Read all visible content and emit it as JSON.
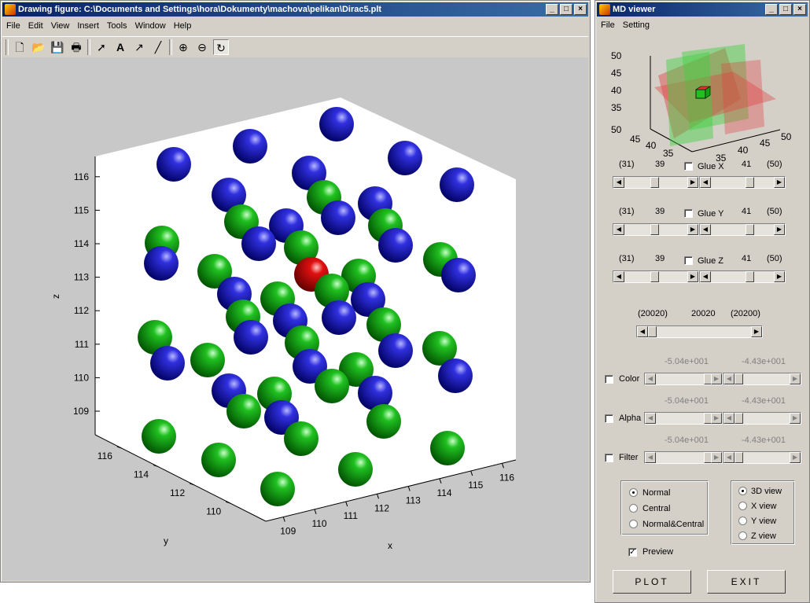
{
  "figure_window": {
    "title": "Drawing figure: C:\\Documents and Settings\\hora\\Dokumenty\\machova\\pelikan\\Dirac5.plt",
    "menu": [
      "File",
      "Edit",
      "View",
      "Insert",
      "Tools",
      "Window",
      "Help"
    ],
    "toolbar": [
      "new-file-icon",
      "open-folder-icon",
      "save-icon",
      "print-icon",
      "select-arrow-icon",
      "text-icon",
      "arrow-icon",
      "line-icon",
      "zoom-in-icon",
      "zoom-out-icon",
      "rotate-3d-icon"
    ]
  },
  "chart_data": {
    "type": "scatter",
    "title": "",
    "xlabel": "x",
    "ylabel": "y",
    "zlabel": "z",
    "x_ticks": [
      "109",
      "110",
      "111",
      "112",
      "113",
      "114",
      "115",
      "116"
    ],
    "y_ticks": [
      "110",
      "112",
      "114",
      "116"
    ],
    "z_ticks": [
      "109",
      "110",
      "111",
      "112",
      "113",
      "114",
      "115",
      "116"
    ],
    "colors": {
      "blue": "#1010b0",
      "green": "#10b010",
      "red": "#d01010",
      "background": "#c8c8c8"
    }
  },
  "viewer_window": {
    "title": "MD viewer",
    "menu": [
      "File",
      "Setting"
    ],
    "preview3d": {
      "z_ticks": [
        "50",
        "45",
        "40",
        "35"
      ],
      "y_ticks": [
        "50",
        "45",
        "40",
        "35"
      ],
      "x_ticks": [
        "35",
        "40",
        "45",
        "50"
      ]
    },
    "x_slider": {
      "left_min": "(31)",
      "left_val": "39",
      "glue_label": "Glue X",
      "right_val": "41",
      "right_max": "(50)"
    },
    "y_slider": {
      "left_min": "(31)",
      "left_val": "39",
      "glue_label": "Glue Y",
      "right_val": "41",
      "right_max": "(50)"
    },
    "z_slider": {
      "left_min": "(31)",
      "left_val": "39",
      "glue_label": "Glue Z",
      "right_val": "41",
      "right_max": "(50)"
    },
    "frame_slider": {
      "min": "(20020)",
      "val": "20020",
      "max": "(20200)"
    },
    "color": {
      "label": "Color",
      "left": "-5.04e+001",
      "right": "-4.43e+001"
    },
    "alpha": {
      "label": "Alpha",
      "left": "-5.04e+001",
      "right": "-4.43e+001"
    },
    "filter": {
      "label": "Filter",
      "left": "-5.04e+001",
      "right": "-4.43e+001"
    },
    "mode_options": [
      "Normal",
      "Central",
      "Normal&Central"
    ],
    "mode_selected": "Normal",
    "view_options": [
      "3D view",
      "X view",
      "Y view",
      "Z view"
    ],
    "view_selected": "3D view",
    "preview_label": "Preview",
    "preview_checked": true,
    "plot_label": "PLOT",
    "exit_label": "EXIT"
  }
}
